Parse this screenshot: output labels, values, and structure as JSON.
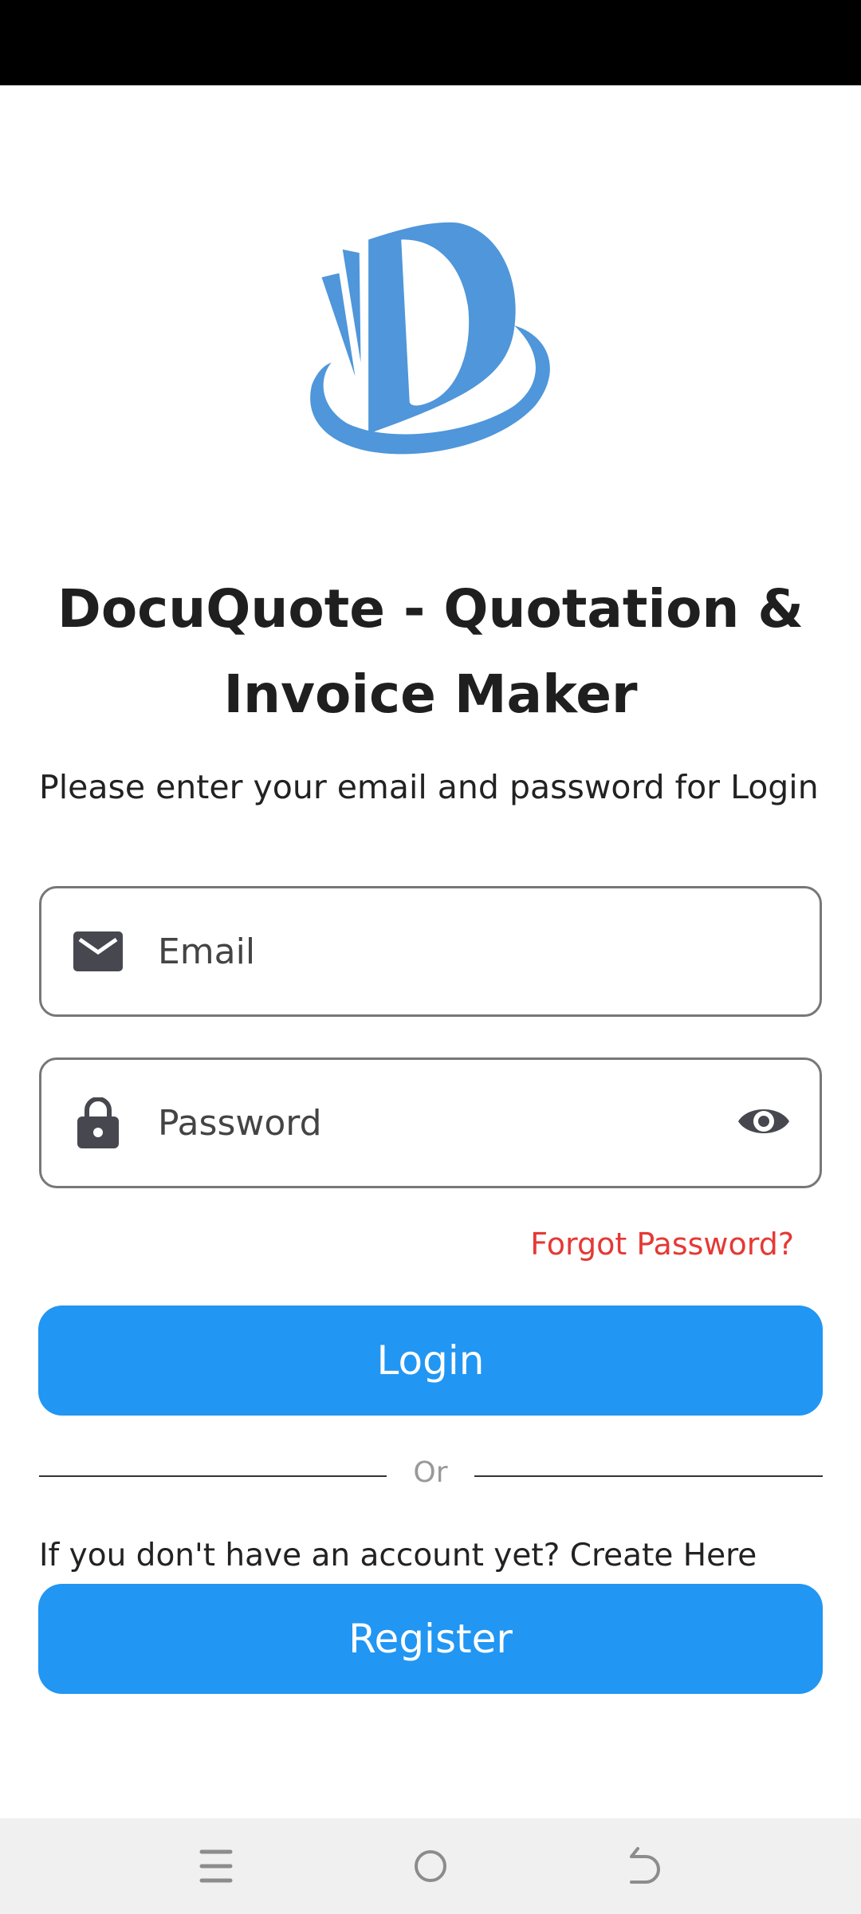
{
  "app": {
    "title_line1": "DocuQuote - Quotation &",
    "title_line2": "Invoice Maker",
    "logo_letter": "D"
  },
  "login": {
    "instructions": "Please enter your email and password for Login",
    "email_placeholder": "Email",
    "password_placeholder": "Password",
    "forgot_label": "Forgot Password?",
    "login_label": "Login",
    "divider_label": "Or",
    "register_prompt": "If you don't have an account yet? Create Here",
    "register_label": "Register"
  },
  "colors": {
    "primary": "#2196F3",
    "logo": "#4F96DA",
    "error": "#E53935"
  },
  "nav": {
    "icons": [
      "menu-icon",
      "home-icon",
      "back-icon"
    ]
  }
}
